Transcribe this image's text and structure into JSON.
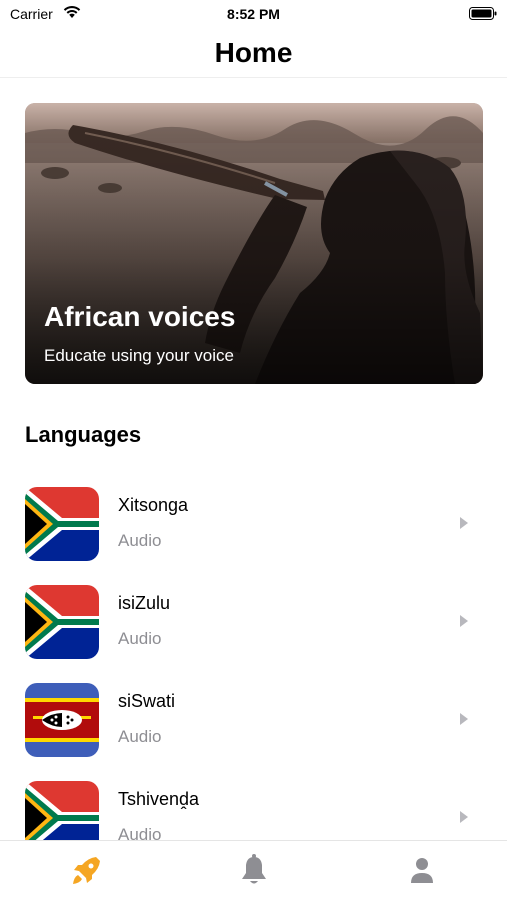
{
  "status_bar": {
    "carrier": "Carrier",
    "time": "8:52 PM"
  },
  "nav": {
    "title": "Home"
  },
  "hero": {
    "title": "African voices",
    "subtitle": "Educate using your voice"
  },
  "languages": {
    "title": "Languages",
    "items": [
      {
        "name": "Xitsonga",
        "type": "Audio",
        "flag": "south-africa-flag"
      },
      {
        "name": "isiZulu",
        "type": "Audio",
        "flag": "south-africa-flag"
      },
      {
        "name": "siSwati",
        "type": "Audio",
        "flag": "eswatini-flag"
      },
      {
        "name": "Tshivenḓa",
        "type": "Audio",
        "flag": "south-africa-flag"
      }
    ]
  },
  "tab_bar": {
    "items": [
      {
        "icon": "rocket-icon",
        "active": true
      },
      {
        "icon": "bell-icon",
        "active": false
      },
      {
        "icon": "person-icon",
        "active": false
      }
    ],
    "active_color": "#f5a623",
    "inactive_color": "#8e8e93"
  }
}
